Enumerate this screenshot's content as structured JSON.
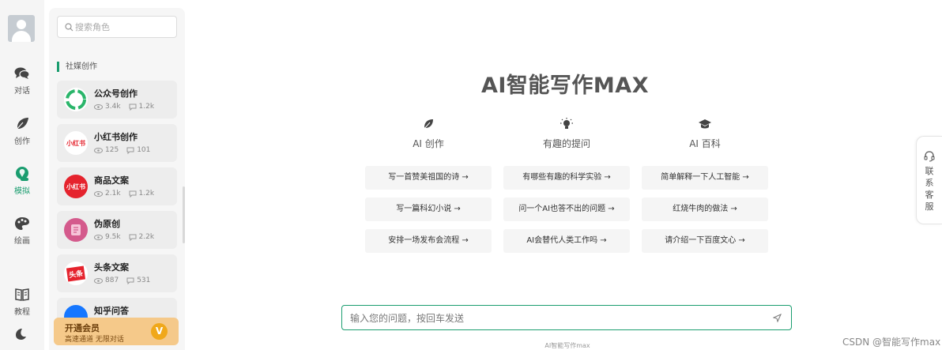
{
  "nav": {
    "items": [
      {
        "label": "对话",
        "icon": "chat-icon"
      },
      {
        "label": "创作",
        "icon": "feather-icon"
      },
      {
        "label": "模拟",
        "icon": "role-icon"
      },
      {
        "label": "绘画",
        "icon": "palette-icon"
      },
      {
        "label": "教程",
        "icon": "book-icon"
      }
    ],
    "active": "模拟",
    "theme_icon": "moon-icon"
  },
  "panel": {
    "search_placeholder": "搜索角色",
    "section_title": "社媒创作",
    "cards": [
      {
        "name": "公众号创作",
        "views": "3.4k",
        "comments": "1.2k",
        "logo": "wechat-logo"
      },
      {
        "name": "小红书创作",
        "views": "125",
        "comments": "101",
        "logo_text": "小红书"
      },
      {
        "name": "商品文案",
        "views": "2.1k",
        "comments": "1.2k",
        "logo_text": "小红书"
      },
      {
        "name": "伪原创",
        "views": "9.5k",
        "comments": "2.2k",
        "logo": "document-logo"
      },
      {
        "name": "头条文案",
        "views": "887",
        "comments": "531",
        "logo_text": "头条"
      },
      {
        "name": "知乎问答",
        "views": "",
        "comments": "",
        "logo": "zhihu-logo"
      }
    ],
    "vip": {
      "title": "开通会员",
      "subtitle": "高速通道 无限对话",
      "badge": "V"
    }
  },
  "main": {
    "title": "AI智能写作MAX",
    "columns": [
      {
        "label": "AI 创作",
        "icon": "leaf-icon",
        "questions": [
          "写一首赞美祖国的诗 →",
          "写一篇科幻小说 →",
          "安排一场发布会流程 →"
        ]
      },
      {
        "label": "有趣的提问",
        "icon": "lightbulb-icon",
        "questions": [
          "有哪些有趣的科学实验 →",
          "问一个AI也答不出的问题 →",
          "AI会替代人类工作吗 →"
        ]
      },
      {
        "label": "AI 百科",
        "icon": "graduation-cap-icon",
        "questions": [
          "简单解释一下人工智能 →",
          "红烧牛肉的做法 →",
          "请介绍一下百度文心 →"
        ]
      }
    ],
    "input_placeholder": "输入您的问题，按回车发送",
    "footer": "AI智能写作max"
  },
  "service": {
    "label": "联系客服"
  },
  "watermark": "CSDN @智能写作max",
  "colors": {
    "accent": "#1a9d6f",
    "vip_bg": "#f5c98a",
    "vip_badge": "#f0a81a"
  }
}
